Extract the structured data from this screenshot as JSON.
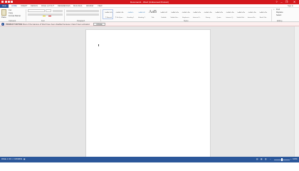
{
  "window": {
    "title": "Document1 - Word (Unlicensed Product)",
    "help": "?",
    "minimize": "–",
    "restore": "❐",
    "close": "✕"
  },
  "tabs": [
    "FILE",
    "HOME",
    "INSERT",
    "DESIGN",
    "PAGE LAYOUT",
    "REFERENCES",
    "MAILINGS",
    "REVIEW",
    "VIEW"
  ],
  "signin": "Sign in",
  "ribbon": {
    "clipboard": {
      "paste": "Paste",
      "cut": "Cut",
      "copy": "Copy",
      "format_painter": "Format Painter",
      "label": "Clipboard"
    },
    "font": {
      "label": "Font"
    },
    "paragraph": {
      "label": "Paragraph"
    },
    "styles": {
      "label": "Styles",
      "items": [
        {
          "sample": "AaBbCcDc",
          "name": "¶ Normal"
        },
        {
          "sample": "AaBbCcDc",
          "name": "¶ No Spac..."
        },
        {
          "sample": "AaBbCc",
          "name": "Heading 1"
        },
        {
          "sample": "AaBbCcE",
          "name": "Heading 2"
        },
        {
          "sample": "AaB",
          "name": "Title"
        },
        {
          "sample": "AaBbCcD",
          "name": "Subtitle"
        },
        {
          "sample": "AaBbCcDa",
          "name": "Subtle Em..."
        },
        {
          "sample": "AaBbCcDa",
          "name": "Emphasis"
        },
        {
          "sample": "AaBbCcDa",
          "name": "Intense E..."
        },
        {
          "sample": "AaBbCcDa",
          "name": "Strong"
        },
        {
          "sample": "AaBbCcDa",
          "name": "Quote"
        },
        {
          "sample": "AaBbCcDa",
          "name": "Intense Q..."
        },
        {
          "sample": "AaBbCcDa",
          "name": "Subtle Ref..."
        },
        {
          "sample": "AaBbCcDa",
          "name": "Intense Re..."
        },
        {
          "sample": "AaBbCcDa",
          "name": "Book Title"
        }
      ]
    },
    "editing": {
      "find": "Find",
      "replace": "Replace",
      "select": "Select",
      "label": "Editing"
    }
  },
  "message_bar": {
    "label": "PRODUCT NOTICE",
    "text": "Most of the features of Word have been disabled because it hasn't been activated.",
    "button": "Activate"
  },
  "status": {
    "page": "PAGE 1 OF 1",
    "words": "0 WORDS",
    "zoom": "100%"
  },
  "colors": {
    "accent": "#d4181d",
    "file_tab": "#2b579a",
    "status_bar": "#2b579a"
  }
}
